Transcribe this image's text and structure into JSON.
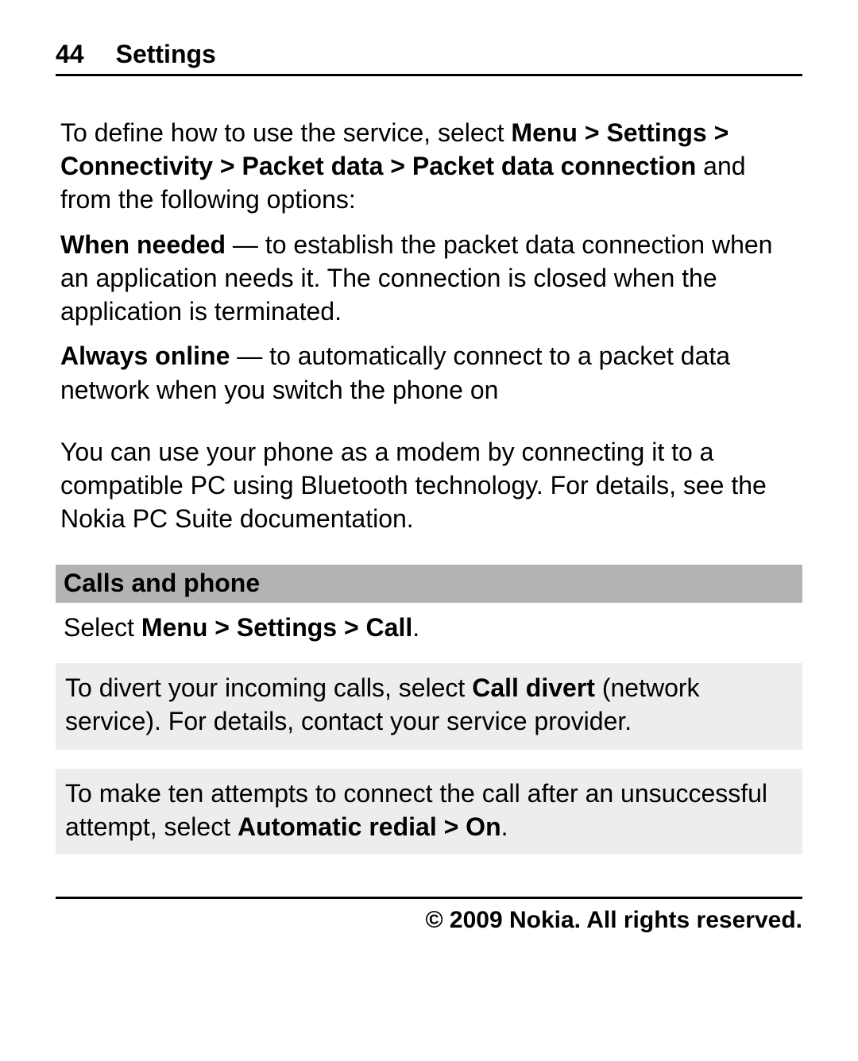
{
  "header": {
    "page_number": "44",
    "title": "Settings"
  },
  "p1": {
    "lead": "To define how to use the service, select ",
    "path": "Menu  > Settings  > Connectivity  > Packet data  > Packet data connection",
    "tail": " and from the following options:"
  },
  "opt1": {
    "name": "When needed",
    "sep": "  —  ",
    "desc": "to establish the packet data connection when an application needs it. The connection is closed when the application is terminated."
  },
  "opt2": {
    "name": "Always online",
    "sep": "  —  ",
    "desc": "to automatically connect to a packet data network when you switch the phone on"
  },
  "p_modem": "You can use your phone as a modem by connecting it to a compatible PC using Bluetooth technology. For details, see the Nokia PC Suite documentation.",
  "section_heading": "Calls and phone",
  "select_line": {
    "lead": "Select ",
    "path": "Menu  >  Settings  >  Call",
    "tail": "."
  },
  "box1": {
    "lead": "To divert your incoming calls, select ",
    "bold": "Call divert",
    "tail": " (network service). For details, contact your service provider."
  },
  "box2": {
    "lead": "To make ten attempts to connect the call after an unsuccessful attempt, select ",
    "bold": "Automatic redial  >  On",
    "tail": "."
  },
  "footer": "© 2009 Nokia. All rights reserved."
}
